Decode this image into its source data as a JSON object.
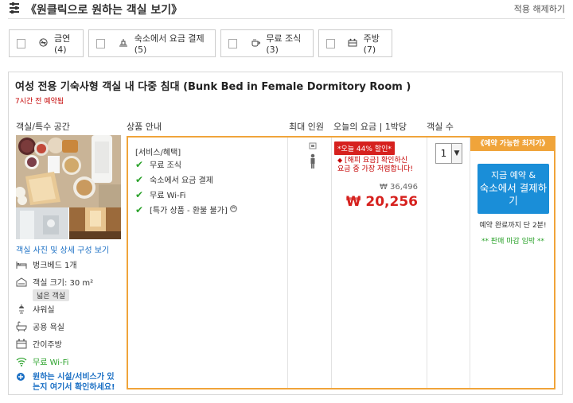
{
  "header": {
    "title": "《원클릭으로 원하는 객실 보기》",
    "reset_label": "적용 해제하기"
  },
  "filters": [
    {
      "icon": "no-smoking-icon",
      "label": "금연 (4)"
    },
    {
      "icon": "pay-at-property-icon",
      "label": "숙소에서 요금 결제 (5)"
    },
    {
      "icon": "coffee-icon",
      "label": "무료 조식 (3)"
    },
    {
      "icon": "kitchen-icon",
      "label": "주방 (7)"
    }
  ],
  "room": {
    "title": "여성 전용 기숙사형 객실 내 다중 침대 (Bunk Bed in Female Dormitory Room )",
    "booked_ago": "7시간 전 예약됨",
    "columns": {
      "room_type": "객실/특수 공간",
      "product_info": "상품 안내",
      "max_guests": "최대 인원",
      "today_rate": "오늘의 요금 | 1박당",
      "rooms": "객실 수"
    },
    "photos_link": "객실 사진 및 상세 구성 보기",
    "amenities": [
      {
        "icon": "bed-icon",
        "label": "벙크베드 1개"
      },
      {
        "icon": "room-size-icon",
        "label": "객실 크기: 30 m²"
      },
      {
        "icon": "shower-icon",
        "label": "샤워실"
      },
      {
        "icon": "bathroom-icon",
        "label": "공용 욕실"
      },
      {
        "icon": "kitchenette-icon",
        "label": "간이주방"
      },
      {
        "icon": "wifi-icon",
        "label": "무료 Wi-Fi"
      }
    ],
    "size_tag": "넓은 객실",
    "help_link_line1": "원하는 시설/서비스가 있",
    "help_link_line2": "는지 여기서 확인하세요!",
    "services_header": "[서비스/혜택]",
    "services": [
      "무료 조식",
      "숙소에서 요금 결제",
      "무료 Wi-Fi",
      "[특가 상품 - 환불 불가]"
    ],
    "discount_badge": "*오늘 44% 할인*",
    "deal_line1": "[해피 요금] 확인하신",
    "deal_line2": "요금 중 가장 저렴합니다!",
    "original_price": "₩ 36,496",
    "sale_price": "₩ 20,256",
    "quantity": "1",
    "best_rate_label": "《예약 가능한 최저가》",
    "book_line1": "지금 예약 &",
    "book_line2": "숙소에서 결제하",
    "book_line3": "기",
    "fast_booking": "예약 완료까지 단 2분!",
    "urgency": "** 판매 마감 임박 **"
  },
  "colors": {
    "accent_orange": "#f0a43a",
    "price_red": "#d6211e",
    "button_blue": "#1a8ed8",
    "link_blue": "#1a6fc4",
    "check_green": "#2aa22a"
  }
}
